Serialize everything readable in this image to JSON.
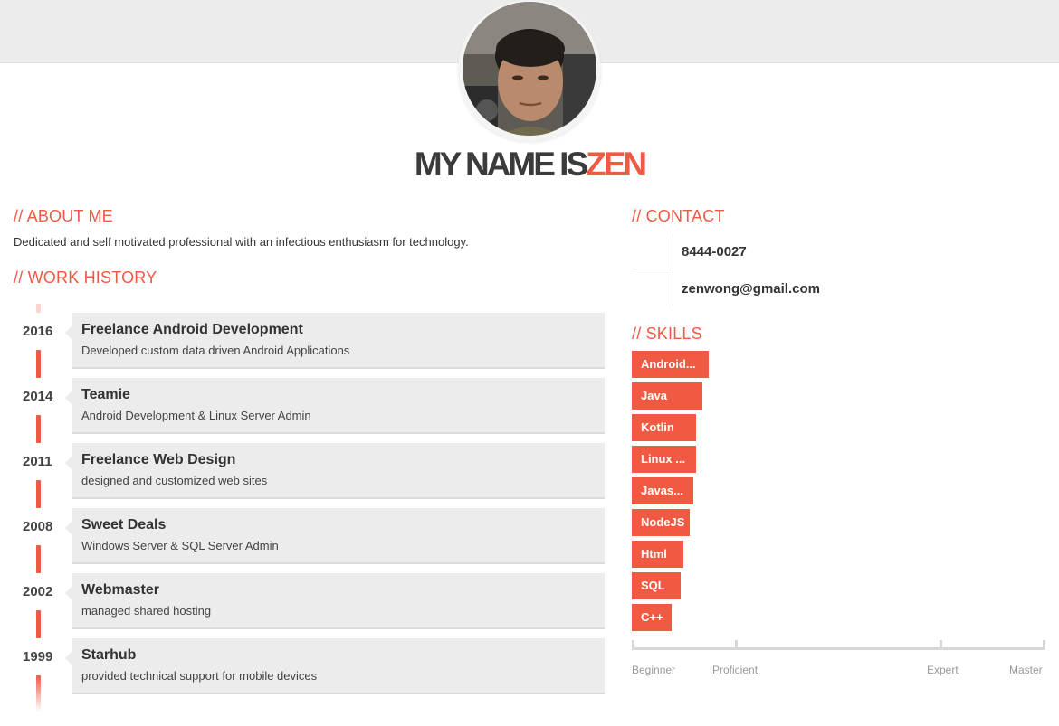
{
  "header": {
    "name_prefix": "MY NAME IS",
    "name_accent": "ZEN"
  },
  "about": {
    "title": "// ABOUT ME",
    "text": "Dedicated and self motivated professional with an infectious enthusiasm for technology."
  },
  "work": {
    "title": "// WORK HISTORY",
    "jobs": [
      {
        "year": "2016",
        "title": "Freelance Android Development",
        "desc": "Developed custom data driven Android Applications"
      },
      {
        "year": "2014",
        "title": "Teamie",
        "desc": "Android Development & Linux Server Admin"
      },
      {
        "year": "2011",
        "title": "Freelance Web Design",
        "desc": "designed and customized web sites"
      },
      {
        "year": "2008",
        "title": "Sweet Deals",
        "desc": "Windows Server & SQL Server Admin"
      },
      {
        "year": "2002",
        "title": "Webmaster",
        "desc": "managed shared hosting"
      },
      {
        "year": "1999",
        "title": "Starhub",
        "desc": "provided technical support for mobile devices"
      }
    ]
  },
  "contact": {
    "title": "// CONTACT",
    "phone": "8444-0027",
    "email": "zenwong@gmail.com"
  },
  "skills": {
    "title": "// SKILLS",
    "items": [
      {
        "label": "Android...",
        "level": 0.186
      },
      {
        "label": "Java",
        "level": 0.171
      },
      {
        "label": "Kotlin",
        "level": 0.155
      },
      {
        "label": "Linux ...",
        "level": 0.155
      },
      {
        "label": "Javas...",
        "level": 0.149
      },
      {
        "label": "NodeJS",
        "level": 0.14
      },
      {
        "label": "Html",
        "level": 0.125
      },
      {
        "label": "SQL",
        "level": 0.118
      },
      {
        "label": "C++",
        "level": 0.096
      }
    ],
    "scale": [
      "Beginner",
      "Proficient",
      "Expert",
      "Master"
    ]
  },
  "colors": {
    "accent": "#ef5a43",
    "card": "#ececec",
    "band": "#ececec"
  }
}
